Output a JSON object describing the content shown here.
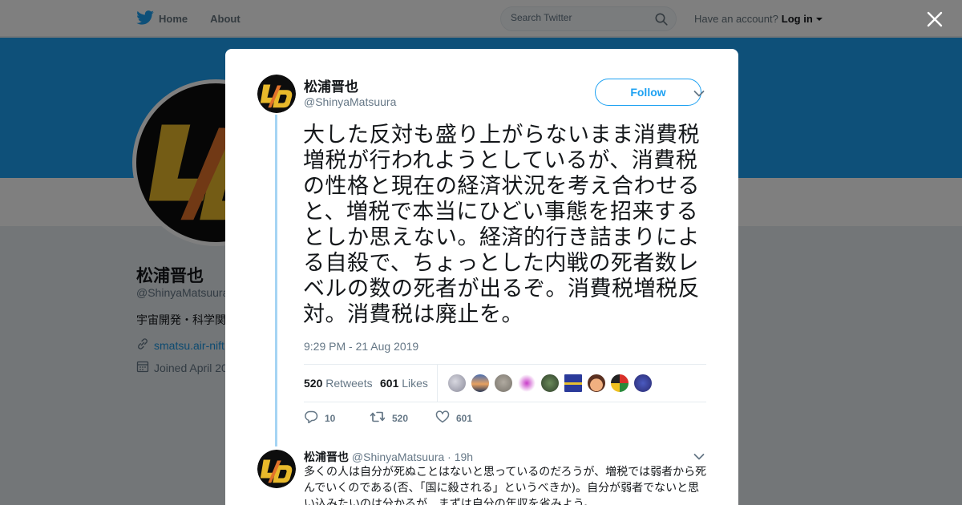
{
  "nav": {
    "home_label": "Home",
    "about_label": "About",
    "search_placeholder": "Search Twitter",
    "have_account": "Have an account?",
    "login_label": "Log in"
  },
  "profile": {
    "name": "松浦晋也",
    "handle": "@ShinyaMatsuura",
    "bio": "宇宙開発・科学関",
    "link": "smatsu.air-nift",
    "joined": "Joined April 20"
  },
  "tweet": {
    "author_name": "松浦晋也",
    "author_handle": "@ShinyaMatsuura",
    "follow_label": "Follow",
    "text": "大した反対も盛り上がらないまま消費税増税が行われようとしているが、消費税の性格と現在の経済状況を考え合わせると、増税で本当にひどい事態を招来するとしか思えない。経済的行き詰まりによる自殺で、ちょっとした内戦の死者数レベルの数の死者が出るぞ。消費税増税反対。消費税は廃止を。",
    "timestamp": "9:29 PM - 21 Aug 2019",
    "retweets_count": "520",
    "retweets_label": "Retweets",
    "likes_count": "601",
    "likes_label": "Likes",
    "actions": {
      "replies": "10",
      "retweets": "520",
      "likes": "601"
    }
  },
  "reply": {
    "author_name": "松浦晋也",
    "author_handle": "@ShinyaMatsuura",
    "time": "· 19h",
    "text": "多くの人は自分が死ぬことはないと思っているのだろうが、増税では弱者から死んでいくのである(否、「国に殺される」というべきか)。自分が弱者でないと思い込みたいのは分かるが、まずは自分の年収を省みよう。"
  },
  "colors": {
    "accent": "#1da1f2",
    "banner": "#1da1f2",
    "logo_gold": "#e8b92b",
    "logo_orange": "#e2722a"
  },
  "icons": [
    "twitter-bird-icon",
    "home-icon",
    "search-icon",
    "close-icon",
    "link-icon",
    "calendar-icon",
    "chevron-down-icon",
    "reply-icon",
    "retweet-icon",
    "heart-icon"
  ]
}
